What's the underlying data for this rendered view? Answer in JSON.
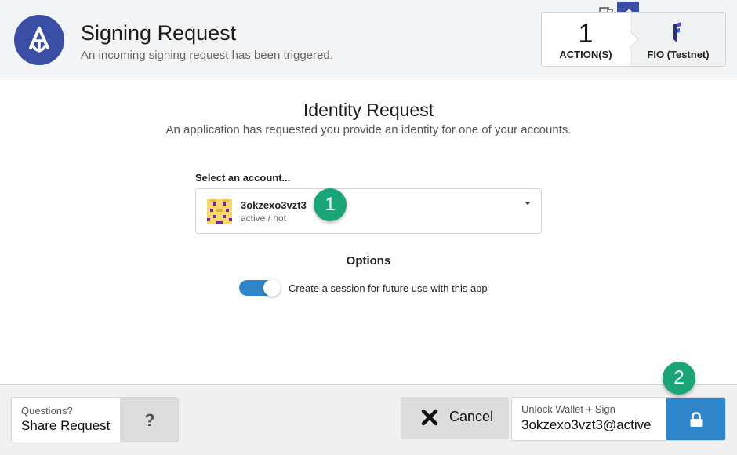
{
  "header": {
    "title": "Signing Request",
    "subtitle": "An incoming signing request has been triggered.",
    "action_count": "1",
    "action_label": "ACTION(S)",
    "chain_label": "FIO (Testnet)"
  },
  "main": {
    "title": "Identity Request",
    "subtitle": "An application has requested you provide an identity for one of your accounts.",
    "select_label": "Select an account...",
    "account_name": "3okzexo3vzt3",
    "account_permission": "active / hot",
    "options_label": "Options",
    "session_toggle_label": "Create a session for future use with this app",
    "session_toggle_on": true
  },
  "annotations": [
    "1",
    "2"
  ],
  "footer": {
    "questions_small": "Questions?",
    "questions_big": "Share Request",
    "help_glyph": "?",
    "cancel_label": "Cancel",
    "sign_small": "Unlock Wallet + Sign",
    "sign_big": "3okzexo3vzt3@active"
  },
  "colors": {
    "brand_blue": "#3a4ea6",
    "accent_blue": "#2e85c9",
    "badge_green": "#1aa579"
  },
  "icons": [
    "anchor-logo-icon",
    "wallet-icon",
    "pin-icon",
    "fio-chain-icon",
    "account-avatar-icon",
    "chevron-down-icon",
    "close-icon",
    "lock-icon"
  ]
}
